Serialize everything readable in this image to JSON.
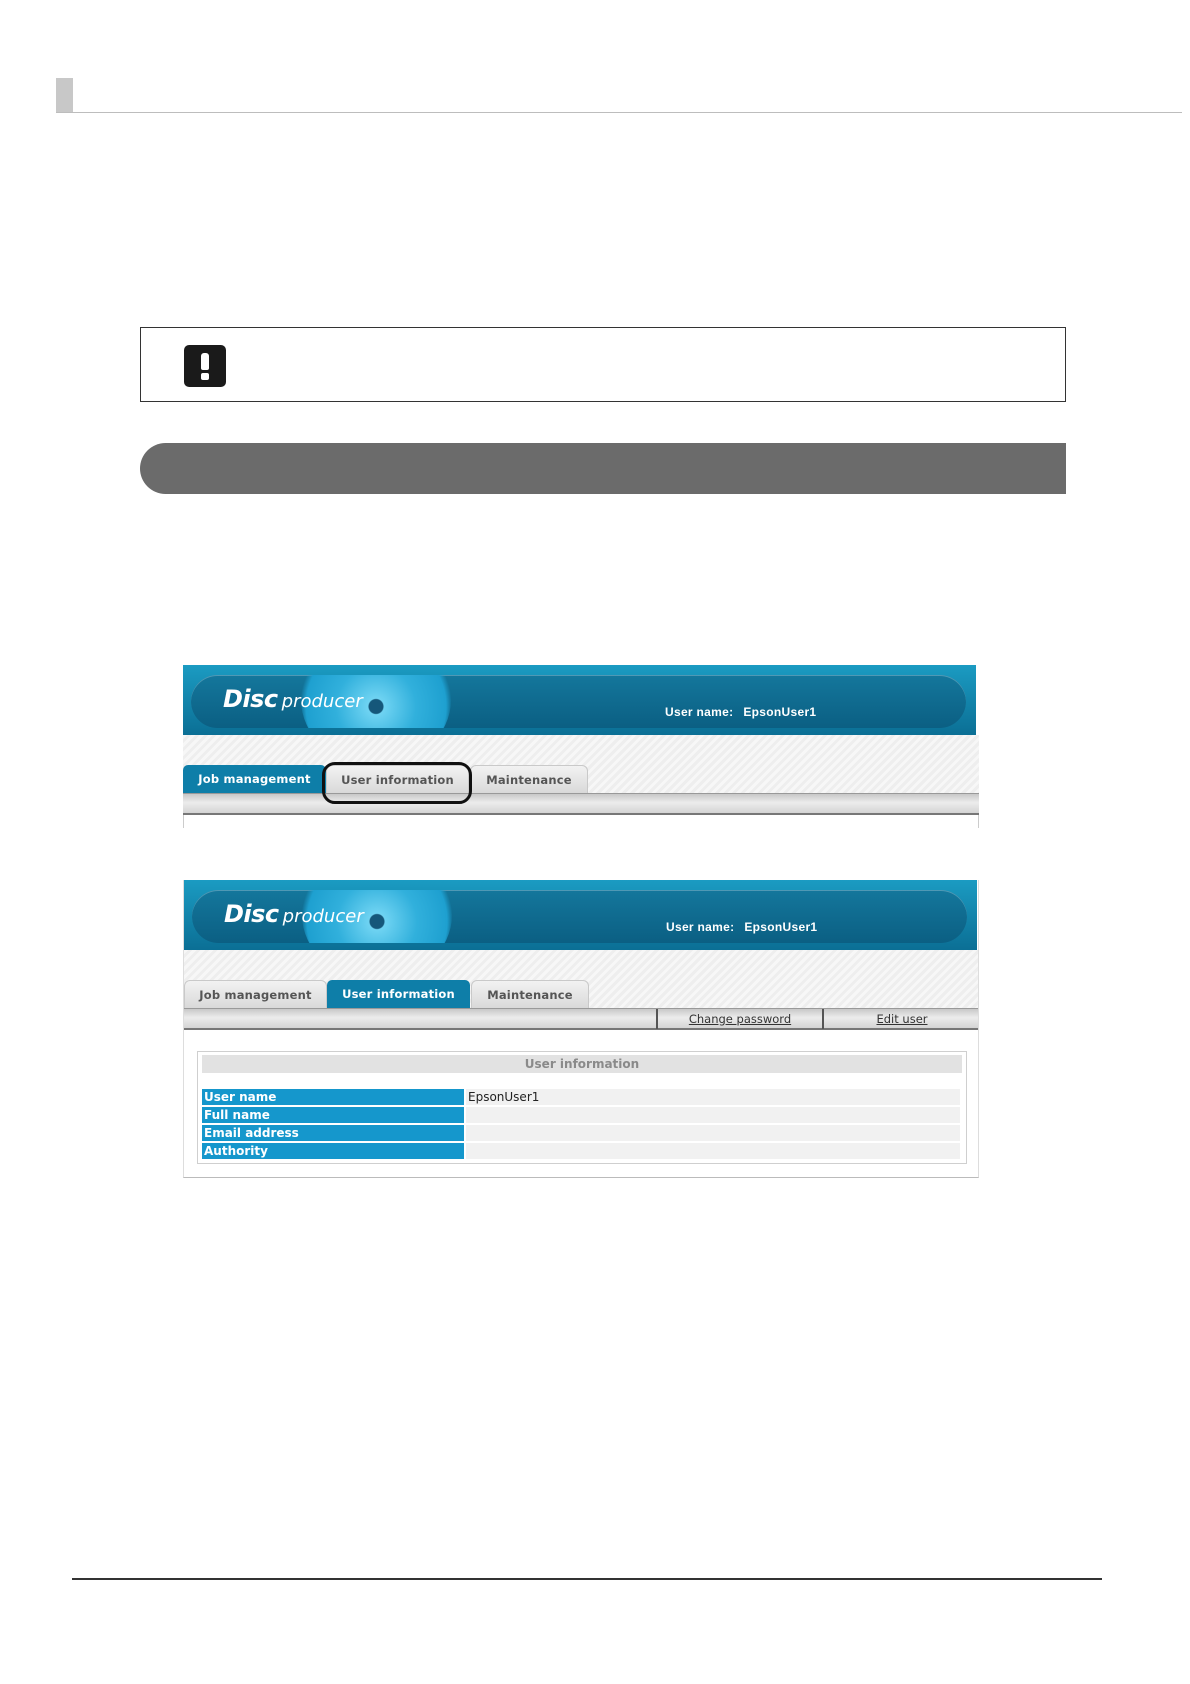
{
  "app": {
    "logo_disc": "Disc",
    "logo_producer": "producer",
    "user_label": "User name:",
    "user_value": "EpsonUser1"
  },
  "tabs": [
    {
      "label": "Job management"
    },
    {
      "label": "User information"
    },
    {
      "label": "Maintenance"
    }
  ],
  "screenshot1": {
    "active_tab": "Job management",
    "highlighted_tab": "User information"
  },
  "screenshot2": {
    "active_tab": "User information",
    "toolbar": {
      "change_password": "Change password",
      "edit_user": "Edit user"
    },
    "panel": {
      "title": "User information",
      "rows": [
        {
          "label": "User name",
          "value": "EpsonUser1"
        },
        {
          "label": "Full name",
          "value": ""
        },
        {
          "label": "Email address",
          "value": ""
        },
        {
          "label": "Authority",
          "value": ""
        }
      ]
    }
  },
  "icons": {
    "note": "exclamation-icon"
  },
  "colors": {
    "header_blue": "#0e7ea8",
    "field_blue": "#1597cc",
    "banner_gray": "#6b6b6b"
  }
}
